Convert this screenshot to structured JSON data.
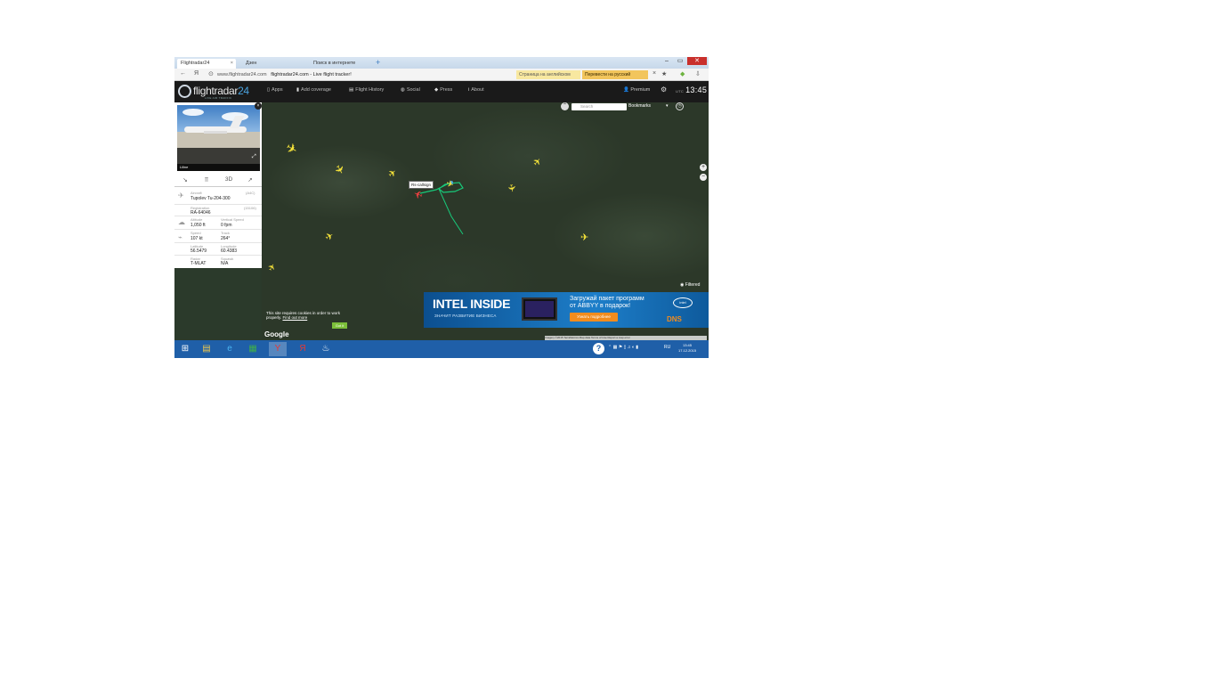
{
  "browser": {
    "tabs": [
      {
        "label": "Flightradar24",
        "active": true
      },
      {
        "label": "Дзен",
        "active": false
      },
      {
        "label": "Поиск в интернете",
        "active": false
      }
    ],
    "new_tab": "+",
    "window_controls": {
      "min": "‒",
      "max": "▭",
      "close": "✕"
    },
    "url_host": "www.flightradar24.com",
    "url_title": "flightradar24.com - Live flight tracker!",
    "translate_label": "Страница на английском",
    "translate_button": "Перевести на русский"
  },
  "header": {
    "logo_main": "flightradar",
    "logo_num": "24",
    "logo_sub": "LIVE AIR TRAFFIC",
    "nav": [
      {
        "icon": "▯",
        "label": "Apps"
      },
      {
        "icon": "▮",
        "label": "Add coverage"
      },
      {
        "icon": "▤",
        "label": "Flight History"
      },
      {
        "icon": "◍",
        "label": "Social"
      },
      {
        "icon": "◆",
        "label": "Press"
      },
      {
        "icon": "i",
        "label": "About"
      }
    ],
    "user": "Premium",
    "clock_zone": "UTC",
    "clock": "13:45"
  },
  "panel": {
    "photo_caption": "Liline",
    "tools": [
      "route",
      "grid",
      "3D",
      "share"
    ],
    "rows": [
      {
        "label": "Aircraft",
        "value": "Tupolev Tu-204-300",
        "label2": "(A4C)",
        "value2": ""
      },
      {
        "label": "Registration",
        "value": "RA-64046",
        "label2": "(15106)",
        "value2": ""
      },
      {
        "label": "Altitude",
        "value": "1,050 ft",
        "label2": "Vertical Speed",
        "value2": "0 fpm"
      },
      {
        "label": "Speed",
        "value": "107 kt",
        "label2": "Track",
        "value2": "264°"
      },
      {
        "label": "Latitude",
        "value": "56.5479",
        "label2": "Longitude",
        "value2": "60.4383"
      },
      {
        "label": "Radar",
        "value": "T-MLAT",
        "label2": "Squawk",
        "value2": "N/A"
      }
    ]
  },
  "map": {
    "search_placeholder": "Search",
    "bookmarks": "Bookmarks",
    "zoom_in": "+",
    "zoom_out": "−",
    "callsign": "Rs-callsign",
    "filter": "Filtered",
    "google": "Google",
    "footer": "Imagery ©2015 TerraMetrics  Map data  Terms of Use  Report a map error"
  },
  "cookie": {
    "text": "This site requires cookies in order to work properly.",
    "link": "Find out more",
    "button": "Got it"
  },
  "ad": {
    "brand": "INTEL INSIDE",
    "tagline": "ЗНАЧИТ РАЗВИТИЕ БИЗНЕСА",
    "line1": "Загружай пакет программ",
    "line2": "от ABBYY в подарок!",
    "button": "Узнать подробнее",
    "intel_logo": "intel",
    "dns": "DNS"
  },
  "taskbar": {
    "apps": [
      "start",
      "files",
      "ie",
      "excel",
      "yandex",
      "yandex-2",
      "steam"
    ],
    "tray": "RU",
    "time": "13:45",
    "date": "17.12.2015"
  },
  "colors": {
    "taskbar": "#1f5fa8",
    "plane": "#f4e23a",
    "selected_plane": "#e84040",
    "track": "#18c97a"
  }
}
